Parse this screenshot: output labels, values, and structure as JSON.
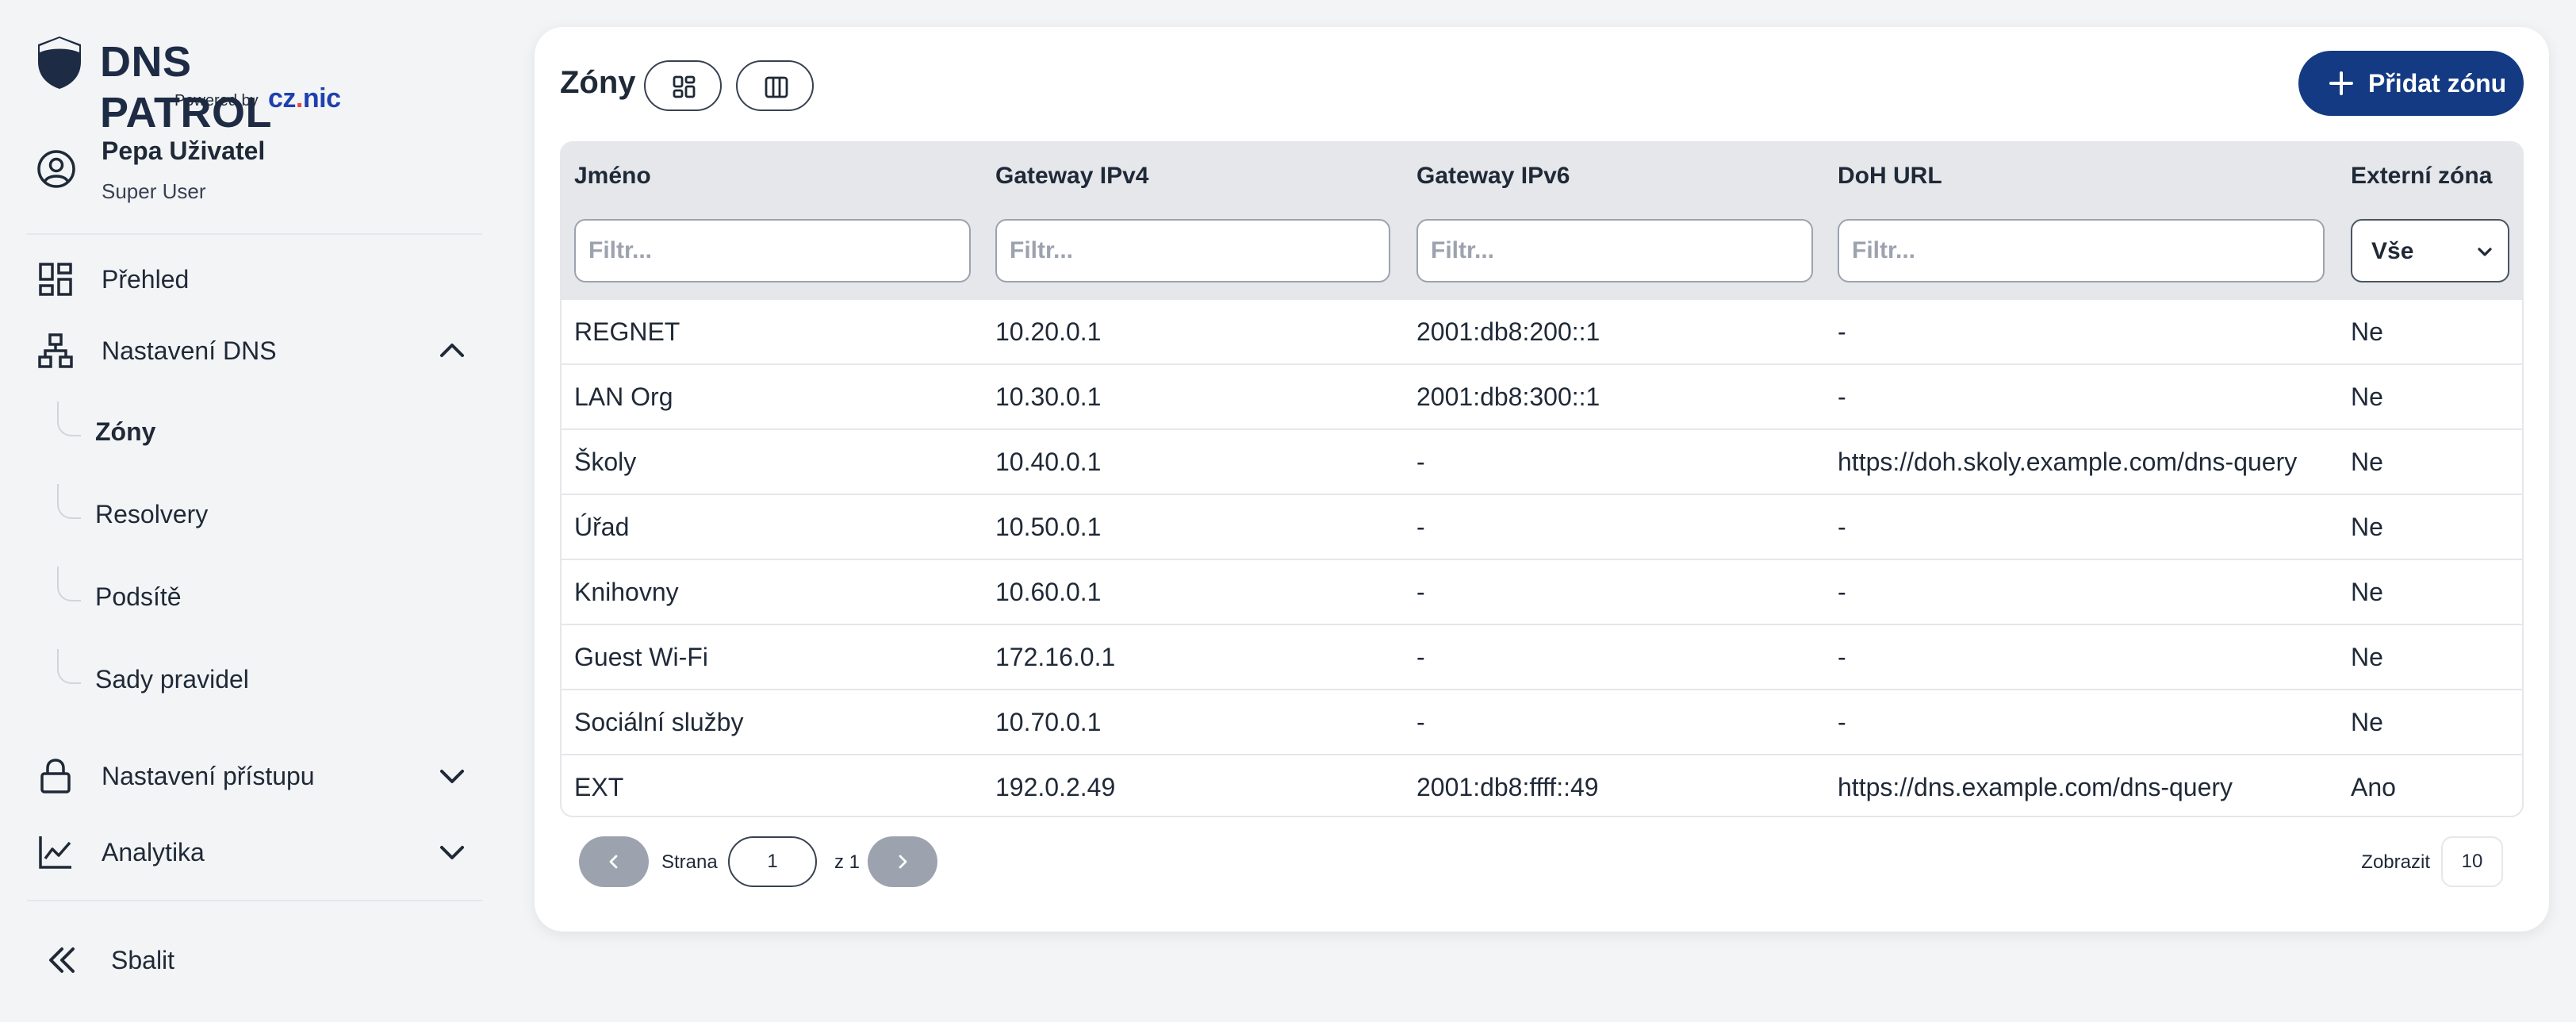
{
  "brand": {
    "name": "DNS PATROL",
    "powered_by": "Powered by",
    "partner_prefix": "cz",
    "partner_dot": ".",
    "partner_suffix": "nic"
  },
  "user": {
    "name": "Pepa Uživatel",
    "role": "Super User"
  },
  "sidebar": {
    "overview": "Přehled",
    "dns_settings": "Nastavení DNS",
    "sub_items": [
      "Zóny",
      "Resolvery",
      "Podsítě",
      "Sady pravidel"
    ],
    "access_settings": "Nastavení přístupu",
    "analytics": "Analytika",
    "collapse": "Sbalit"
  },
  "main": {
    "title": "Zóny",
    "add_button": "Přidat zónu",
    "columns": [
      "Jméno",
      "Gateway IPv4",
      "Gateway IPv6",
      "DoH URL",
      "Externí zóna"
    ],
    "filter_placeholder": "Filtr...",
    "external_filter_value": "Vše",
    "rows": [
      [
        "REGNET",
        "10.20.0.1",
        "2001:db8:200::1",
        "-",
        "Ne"
      ],
      [
        "LAN Org",
        "10.30.0.1",
        "2001:db8:300::1",
        "-",
        "Ne"
      ],
      [
        "Školy",
        "10.40.0.1",
        "-",
        "https://doh.skoly.example.com/dns-query",
        "Ne"
      ],
      [
        "Úřad",
        "10.50.0.1",
        "-",
        "-",
        "Ne"
      ],
      [
        "Knihovny",
        "10.60.0.1",
        "-",
        "-",
        "Ne"
      ],
      [
        "Guest Wi-Fi",
        "172.16.0.1",
        "-",
        "-",
        "Ne"
      ],
      [
        "Sociální služby",
        "10.70.0.1",
        "-",
        "-",
        "Ne"
      ],
      [
        "EXT",
        "192.0.2.49",
        "2001:db8:ffff::49",
        "https://dns.example.com/dns-query",
        "Ano"
      ]
    ]
  },
  "pagination": {
    "page_label": "Strana",
    "current_page": "1",
    "of_label": "z 1",
    "show_label": "Zobrazit",
    "page_size": "10"
  },
  "colors": {
    "primary": "#133a83",
    "brand_text": "#1e2b45",
    "partner": "#1e40af",
    "accent_dot": "#ef4444",
    "header_bg": "#e5e7eb",
    "page_bg": "#f3f4f6"
  }
}
